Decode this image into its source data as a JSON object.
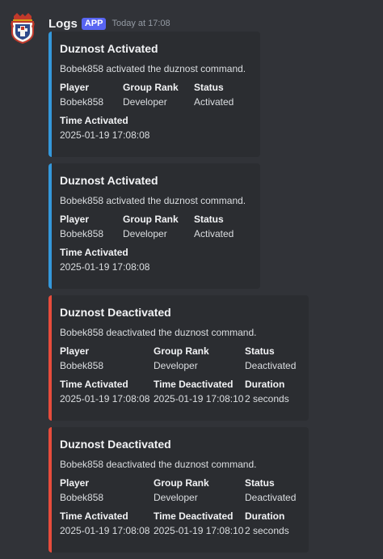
{
  "message": {
    "username": "Logs",
    "badge": "APP",
    "timestamp": "Today at 17:08",
    "avatar_icon": "crest-shield-icon"
  },
  "colors": {
    "activated_bar": "#3498db",
    "deactivated_bar": "#e74c3c",
    "badge": "#5865f2"
  },
  "embeds": [
    {
      "title": "Duznost Activated",
      "description": "Bobek858 activated the duznost command.",
      "fields": {
        "player_name": "Player",
        "player_value": "Bobek858",
        "rank_name": "Group Rank",
        "rank_value": "Developer",
        "status_name": "Status",
        "status_value": "Activated",
        "time_act_name": "Time Activated",
        "time_act_value": "2025-01-19 17:08:08"
      }
    },
    {
      "title": "Duznost Activated",
      "description": "Bobek858 activated the duznost command.",
      "fields": {
        "player_name": "Player",
        "player_value": "Bobek858",
        "rank_name": "Group Rank",
        "rank_value": "Developer",
        "status_name": "Status",
        "status_value": "Activated",
        "time_act_name": "Time Activated",
        "time_act_value": "2025-01-19 17:08:08"
      }
    },
    {
      "title": "Duznost Deactivated",
      "description": "Bobek858 deactivated the duznost command.",
      "fields": {
        "player_name": "Player",
        "player_value": "Bobek858",
        "rank_name": "Group Rank",
        "rank_value": "Developer",
        "status_name": "Status",
        "status_value": "Deactivated",
        "time_act_name": "Time Activated",
        "time_act_value": "2025-01-19 17:08:08",
        "time_deact_name": "Time Deactivated",
        "time_deact_value": "2025-01-19 17:08:10",
        "duration_name": "Duration",
        "duration_value": "2 seconds"
      }
    },
    {
      "title": "Duznost Deactivated",
      "description": "Bobek858 deactivated the duznost command.",
      "fields": {
        "player_name": "Player",
        "player_value": "Bobek858",
        "rank_name": "Group Rank",
        "rank_value": "Developer",
        "status_name": "Status",
        "status_value": "Deactivated",
        "time_act_name": "Time Activated",
        "time_act_value": "2025-01-19 17:08:08",
        "time_deact_name": "Time Deactivated",
        "time_deact_value": "2025-01-19 17:08:10",
        "duration_name": "Duration",
        "duration_value": "2 seconds"
      }
    }
  ]
}
